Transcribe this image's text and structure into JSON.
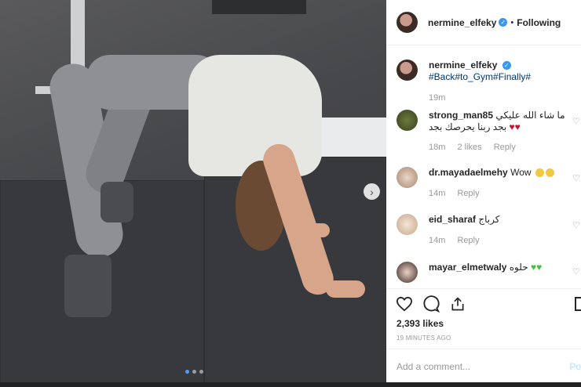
{
  "post": {
    "image_alt": "Woman doing a backbend on a gym floor",
    "carousel_dots": 3,
    "active_dot": 0
  },
  "header": {
    "username": "nermine_elfeky",
    "separator": "•",
    "follow_status": "Following"
  },
  "caption": {
    "username": "nermine_elfeky",
    "text": "#Back#to_Gym#Finally#",
    "time": "19m"
  },
  "comments": [
    {
      "username": "strong_man85",
      "text": "ما شاء الله عليكي بجد ربنا يحرصك بجد",
      "hearts": "♥♥",
      "time": "18m",
      "likes": "2 likes",
      "reply": "Reply"
    },
    {
      "username": "dr.mayadaelmehy",
      "text": "Wow",
      "time": "14m",
      "reply": "Reply"
    },
    {
      "username": "eid_sharaf",
      "text": "كرباج",
      "time": "14m",
      "reply": "Reply"
    },
    {
      "username": "mayar_elmetwaly",
      "text": "حلوه",
      "hearts": "♥♥"
    }
  ],
  "actions": {
    "likes": "2,393 likes",
    "timestamp": "19 MINUTES AGO",
    "add_comment_placeholder": "Add a comment...",
    "post_label": "Po"
  },
  "colors": {
    "accent": "#3897f0",
    "link": "#003569",
    "muted": "#999999"
  }
}
